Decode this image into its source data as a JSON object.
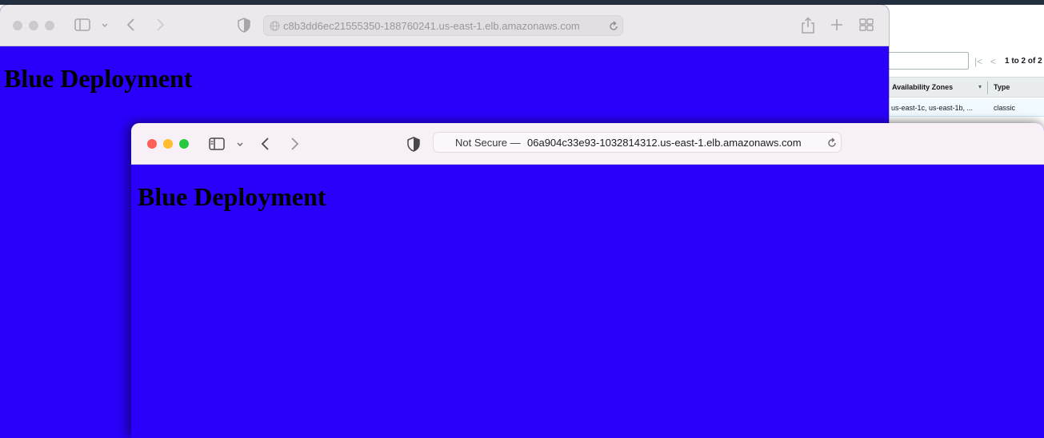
{
  "background_console": {
    "pager_text": "1 to 2 of 2",
    "first_page_icon": "first-page-icon",
    "prev_page_icon": "chevron-left-icon",
    "columns": [
      "Availability Zones",
      "Type"
    ],
    "sort_icon": "sort-caret-icon",
    "rows": [
      {
        "availability_zones": "us-east-1c, us-east-1b, ...",
        "type": "classic"
      }
    ]
  },
  "window_back": {
    "url": "c8b3dd6ec21555350-188760241.us-east-1.elb.amazonaws.com",
    "heading": "Blue Deployment",
    "page_color": "#2a00fb"
  },
  "window_front": {
    "url_prefix": "Not Secure —",
    "url": "06a904c33e93-1032814312.us-east-1.elb.amazonaws.com",
    "heading": "Blue Deployment",
    "page_color": "#2a00fb"
  },
  "icons": {
    "sidebar": "sidebar-icon",
    "chevron_down": "chevron-down-icon",
    "back": "chevron-left-icon",
    "forward": "chevron-right-icon",
    "shield": "shield-icon",
    "globe": "globe-icon",
    "reload": "reload-icon",
    "share": "share-icon",
    "new_tab": "plus-icon",
    "tab_overview": "tab-overview-icon"
  },
  "traffic_colors": {
    "close": "#fe5f57",
    "minimize": "#febc2e",
    "zoom": "#28c840",
    "inactive": "#cdcacd"
  }
}
